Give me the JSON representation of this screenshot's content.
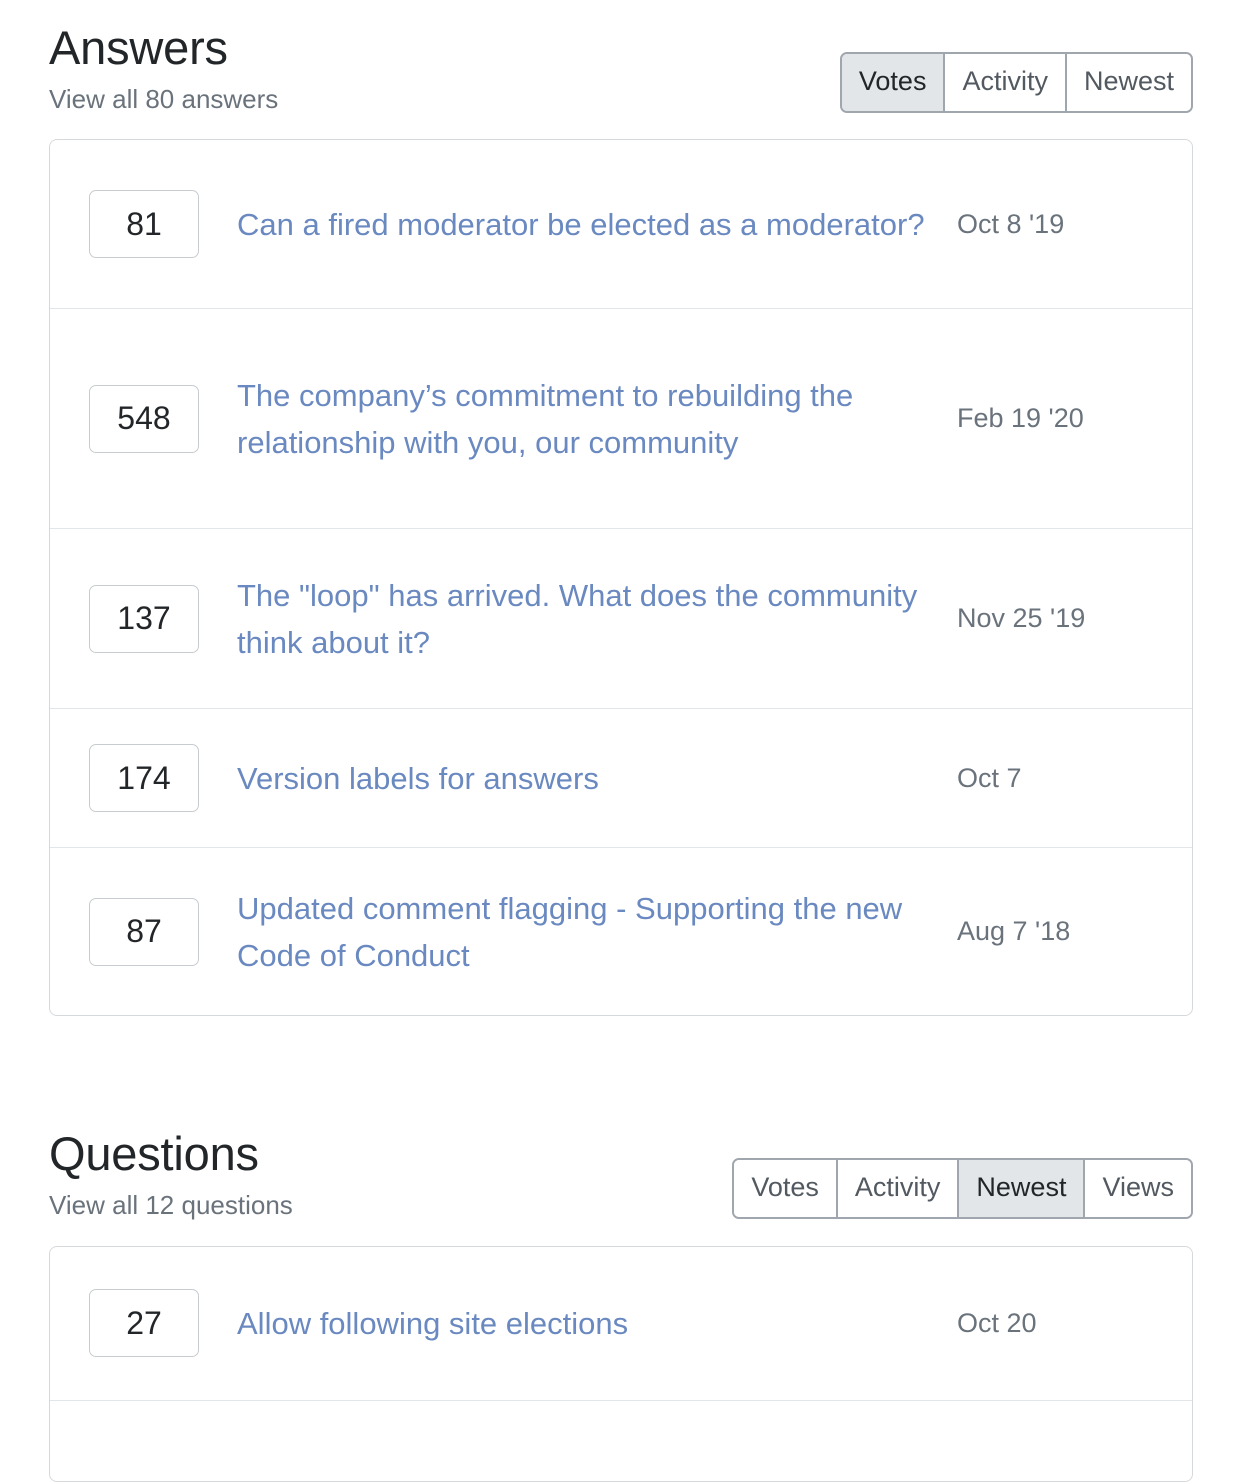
{
  "answers": {
    "title": "Answers",
    "subtitle": "View all 80 answers",
    "tabs": [
      {
        "label": "Votes",
        "selected": true
      },
      {
        "label": "Activity",
        "selected": false
      },
      {
        "label": "Newest",
        "selected": false
      }
    ],
    "rows": [
      {
        "votes": "81",
        "title": "Can a fired moderator be elected as a moderator?",
        "date": "Oct 8 '19"
      },
      {
        "votes": "548",
        "title": "The company’s commitment to rebuilding the relationship with you, our community",
        "date": "Feb 19 '20"
      },
      {
        "votes": "137",
        "title": "The \"loop\" has arrived. What does the community think about it?",
        "date": "Nov 25 '19"
      },
      {
        "votes": "174",
        "title": "Version labels for answers",
        "date": "Oct 7"
      },
      {
        "votes": "87",
        "title": "Updated comment flagging - Supporting the new Code of Conduct",
        "date": "Aug 7 '18"
      }
    ]
  },
  "questions": {
    "title": "Questions",
    "subtitle": "View all 12 questions",
    "tabs": [
      {
        "label": "Votes",
        "selected": false
      },
      {
        "label": "Activity",
        "selected": false
      },
      {
        "label": "Newest",
        "selected": true
      },
      {
        "label": "Views",
        "selected": false
      }
    ],
    "rows": [
      {
        "votes": "27",
        "title": "Allow following site elections",
        "date": "Oct 20"
      }
    ]
  },
  "colors": {
    "link": "#6a89c0",
    "muted": "#6a737c",
    "text": "#232629",
    "border": "#d6d9dc",
    "tab_selected_bg": "#e3e6e8"
  }
}
